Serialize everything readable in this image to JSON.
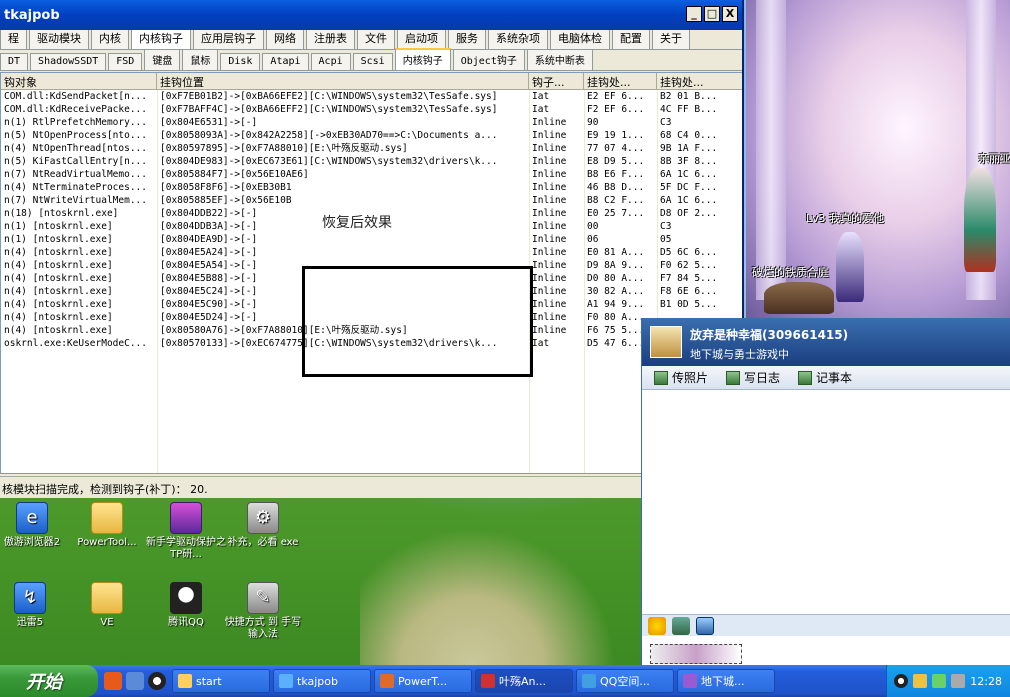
{
  "window": {
    "title": "tkajpob",
    "buttons": {
      "minimize": "_",
      "maximize": "□",
      "close": "X"
    }
  },
  "main_tabs": [
    "程",
    "驱动模块",
    "内核",
    "内核钩子",
    "应用层钩子",
    "网络",
    "注册表",
    "文件",
    "启动项",
    "服务",
    "系统杂项",
    "电脑体检",
    "配置",
    "关于"
  ],
  "active_main_tab": 3,
  "sub_tabs": [
    "DT",
    "ShadowSSDT",
    "FSD",
    "键盘",
    "鼠标",
    "Disk",
    "Atapi",
    "Acpi",
    "Scsi",
    "内核钩子",
    "Object钩子",
    "系统中断表"
  ],
  "active_sub_tab": 9,
  "columns": [
    "钩对象",
    "挂钩位置",
    "钩子...",
    "挂钩处...",
    "挂钩处..."
  ],
  "rows": [
    [
      "COM.dll:KdSendPacket[n...",
      "[0xF7EB01B2]->[0xBA66EFE2][C:\\WINDOWS\\system32\\TesSafe.sys]",
      "Iat",
      "E2 EF 6...",
      "B2 01 B..."
    ],
    [
      "COM.dll:KdReceivePacke...",
      "[0xF7BAFF4C]->[0xBA66EFF2][C:\\WINDOWS\\system32\\TesSafe.sys]",
      "Iat",
      "F2 EF 6...",
      "4C FF B..."
    ],
    [
      "n(1) RtlPrefetchMemory...",
      "[0x804E6531]->[-]",
      "Inline",
      "90",
      "C3"
    ],
    [
      "n(5) NtOpenProcess[nto...",
      "[0x8058093A]->[0x842A2258][->0xEB30AD70==>C:\\Documents a...",
      "Inline",
      "E9 19 1...",
      "68 C4 0..."
    ],
    [
      "n(4) NtOpenThread[ntos...",
      "[0x80597895]->[0xF7A88010][E:\\叶殇反驱动.sys]",
      "Inline",
      "77 07 4...",
      "9B 1A F..."
    ],
    [
      "n(5) KiFastCallEntry[n...",
      "[0x804DE983]->[0xEC673E61][C:\\WINDOWS\\system32\\drivers\\k...",
      "Inline",
      "E8 D9 5...",
      "8B 3F 8..."
    ],
    [
      "n(7) NtReadVirtualMemo...",
      "[0x805884F7]->[0x56E10AE6]",
      "Inline",
      "B8 E6 F...",
      "6A 1C 6..."
    ],
    [
      "n(4) NtTerminateProces...",
      "[0x8058F8F6]->[0xEB30B1",
      "Inline",
      "46 B8 D...",
      "5F DC F..."
    ],
    [
      "n(7) NtWriteVirtualMem...",
      "[0x805885EF]->[0x56E10B",
      "Inline",
      "B8 C2 F...",
      "6A 1C 6..."
    ],
    [
      "n(18) [ntoskrnl.exe]",
      "[0x804DDB22]->[-]",
      "Inline",
      "E0 25 7...",
      "D8 OF 2..."
    ],
    [
      "n(1) [ntoskrnl.exe]",
      "[0x804DDB3A]->[-]",
      "Inline",
      "00",
      "C3"
    ],
    [
      "n(1) [ntoskrnl.exe]",
      "[0x804DEA9D]->[-]",
      "Inline",
      "06",
      "05"
    ],
    [
      "n(4) [ntoskrnl.exe]",
      "[0x804E5A24]->[-]",
      "Inline",
      "E0 81 A...",
      "D5 6C 6..."
    ],
    [
      "n(4) [ntoskrnl.exe]",
      "[0x804E5A54]->[-]",
      "Inline",
      "D9 8A 9...",
      "F0 62 5..."
    ],
    [
      "n(4) [ntoskrnl.exe]",
      "[0x804E5B88]->[-]",
      "Inline",
      "D0 80 A...",
      "F7 84 5..."
    ],
    [
      "n(4) [ntoskrnl.exe]",
      "[0x804E5C24]->[-]",
      "Inline",
      "30 82 A...",
      "F8 6E 6..."
    ],
    [
      "n(4) [ntoskrnl.exe]",
      "[0x804E5C90]->[-]",
      "Inline",
      "A1 94 9...",
      "B1 0D 5..."
    ],
    [
      "n(4) [ntoskrnl.exe]",
      "[0x804E5D24]->[-]",
      "Inline",
      "F0 80 A...",
      ""
    ],
    [
      "n(4) [ntoskrnl.exe]",
      "[0x80580A76]->[0xF7A88010][E:\\叶殇反驱动.sys]",
      "Inline",
      "F6 75 5...",
      ""
    ],
    [
      "oskrnl.exe:KeUserModeC...",
      "[0x80570133]->[0xEC674775][C:\\WINDOWS\\system32\\drivers\\k...",
      "Iat",
      "D5 47 6...",
      "33 C7 6..."
    ]
  ],
  "status": "核模块扫描完成，检测到钩子(补丁)： 20.",
  "annotation": "恢复后效果",
  "desktop_icons": [
    {
      "label": "傲游浏览器2"
    },
    {
      "label": "PowerTool..."
    },
    {
      "label": "新手学驱动保护之TP研..."
    },
    {
      "label": "补充，必看 exe"
    },
    {
      "label": "迅雷5"
    },
    {
      "label": "VE"
    },
    {
      "label": "腾讯QQ"
    },
    {
      "label": "快捷方式 到 手写输入法"
    }
  ],
  "game": {
    "labels": [
      "Lv3 我真的爱他",
      "破烂的铁质合庭",
      "亲丽亚"
    ]
  },
  "qq": {
    "name": "放弃是种幸福(309661415)",
    "status": "地下城与勇士游戏中",
    "tabs": [
      "传照片",
      "写日志",
      "记事本"
    ]
  },
  "taskbar": {
    "start_label": "开始",
    "tasks": [
      "start",
      "tkajpob",
      "PowerT...",
      "叶殇An...",
      "QQ空间...",
      "地下城..."
    ],
    "active_task": 3,
    "clock": "12:28"
  },
  "colors": {
    "accent": "#0a5fe0",
    "start_green": "#3a9a3a"
  }
}
